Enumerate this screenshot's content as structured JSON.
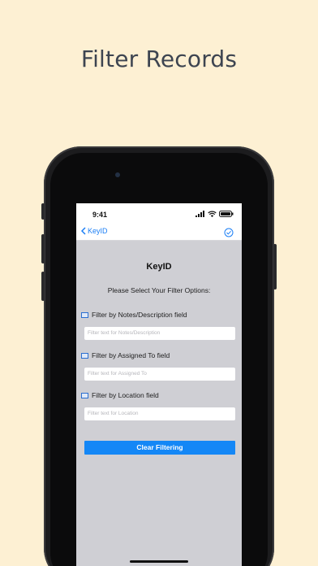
{
  "headline": "Filter Records",
  "status_bar": {
    "time": "9:41"
  },
  "nav": {
    "back_label": "KeyID",
    "back_icon": "chevron-left-icon",
    "done_icon": "checkmark-circle-icon",
    "accent": "#1a7ef5"
  },
  "app": {
    "title": "KeyID",
    "prompt": "Please Select Your Filter Options:",
    "filters": [
      {
        "label": "Filter by Notes/Description field",
        "placeholder": "Filter text for Notes/Description"
      },
      {
        "label": "Filter by Assigned To field",
        "placeholder": "Filter text for Assigned To"
      },
      {
        "label": "Filter by Location field",
        "placeholder": "Filter text for Location"
      }
    ],
    "clear_button": "Clear Filtering"
  },
  "colors": {
    "background": "#fdf0d3",
    "button": "#1487f6",
    "content_bg": "#cfcfd4"
  }
}
